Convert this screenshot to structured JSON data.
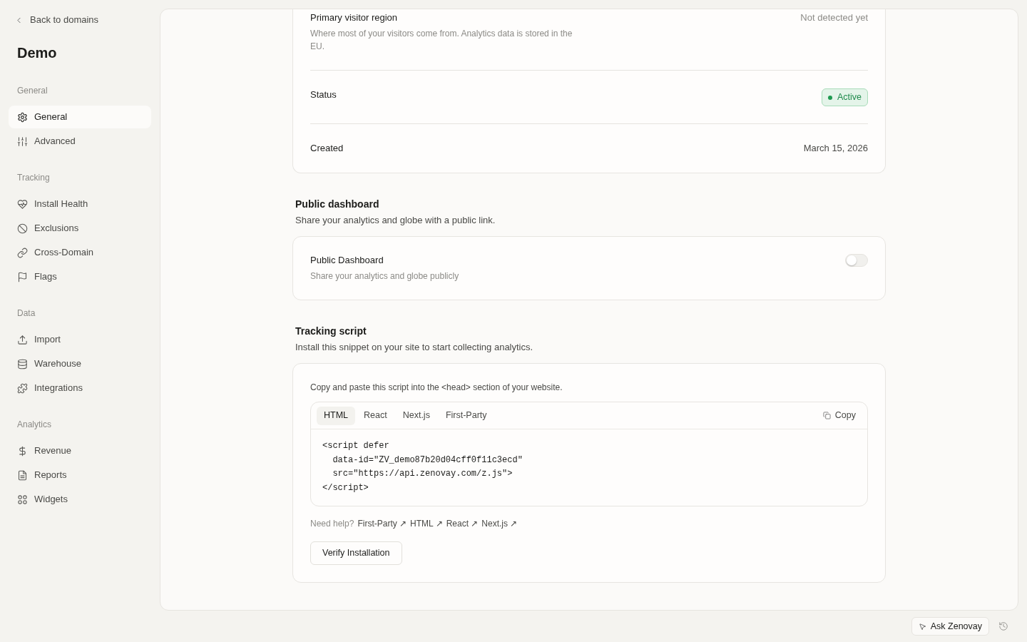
{
  "sidebar": {
    "back_link": "Back to domains",
    "title": "Demo",
    "sections": [
      {
        "label": "General",
        "items": [
          {
            "label": "General",
            "selected": true
          },
          {
            "label": "Advanced",
            "selected": false
          }
        ]
      },
      {
        "label": "Tracking",
        "items": [
          {
            "label": "Install Health",
            "selected": false
          },
          {
            "label": "Exclusions",
            "selected": false
          },
          {
            "label": "Cross-Domain",
            "selected": false
          },
          {
            "label": "Flags",
            "selected": false
          }
        ]
      },
      {
        "label": "Data",
        "items": [
          {
            "label": "Import",
            "selected": false
          },
          {
            "label": "Warehouse",
            "selected": false
          },
          {
            "label": "Integrations",
            "selected": false
          }
        ]
      },
      {
        "label": "Analytics",
        "items": [
          {
            "label": "Revenue",
            "selected": false
          },
          {
            "label": "Reports",
            "selected": false
          },
          {
            "label": "Widgets",
            "selected": false
          }
        ]
      }
    ]
  },
  "details": {
    "rows": [
      {
        "kind": "text",
        "label": "Primary visitor region",
        "description": "Where most of your visitors come from. Analytics data is stored in the EU.",
        "value": "Not detected yet",
        "muted": true
      },
      {
        "kind": "badge",
        "label": "Status",
        "value": "Active"
      },
      {
        "kind": "text",
        "label": "Created",
        "value": "March 15, 2026",
        "muted": false
      }
    ]
  },
  "public_dashboard": {
    "heading": "Public dashboard",
    "description": "Share your analytics and globe with a public link.",
    "setting": {
      "label": "Public Dashboard",
      "description": "Share your analytics and globe publicly",
      "on": false
    }
  },
  "tracking_script": {
    "heading": "Tracking script",
    "description": "Install this snippet on your site to start collecting analytics.",
    "instruction": "Copy and paste this script into the <head> section of your website.",
    "tabs": [
      {
        "label": "HTML",
        "selected": true
      },
      {
        "label": "React",
        "selected": false
      },
      {
        "label": "Next.js",
        "selected": false
      },
      {
        "label": "First-Party",
        "selected": false
      }
    ],
    "copy_button": "Copy",
    "code_lines": [
      "<script defer",
      "  data-id=\"ZV_demo87b20d04cff0f11c3ecd\"",
      "  src=\"https://api.zenovay.com/z.js\">",
      "</script>"
    ],
    "help": {
      "label": "Need help?",
      "links": [
        "First-Party ↗",
        "HTML ↗",
        "React ↗",
        "Next.js ↗"
      ]
    },
    "verify_button": "Verify Installation"
  },
  "footer": {
    "ask_button": "Ask Zenovay"
  }
}
